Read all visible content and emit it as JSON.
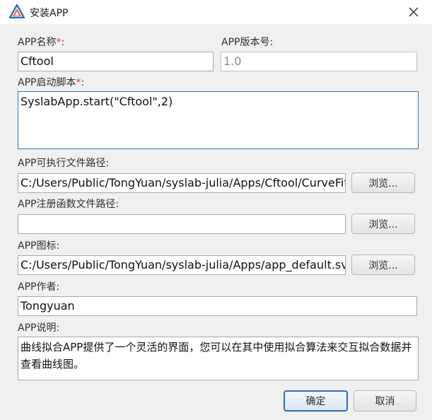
{
  "window": {
    "title": "安装APP"
  },
  "icons": {
    "logo": "app-logo-triangle-icon",
    "close": "close-icon"
  },
  "form": {
    "name": {
      "label": "APP名称",
      "required_mark": "*",
      "suffix": ":",
      "value": "Cftool"
    },
    "version": {
      "label": "APP版本号:",
      "value": "1.0"
    },
    "startup": {
      "label": "APP启动脚本",
      "required_mark": "*",
      "suffix": ":",
      "value": "SyslabApp.start(\"Cftool\",2)"
    },
    "exe_path": {
      "label": "APP可执行文件路径:",
      "value": "C:/Users/Public/TongYuan/syslab-julia/Apps/Cftool/CurveFitTool",
      "browse": "浏览..."
    },
    "reg_path": {
      "label": "APP注册函数文件路径:",
      "value": "",
      "browse": "浏览..."
    },
    "icon_path": {
      "label": "APP图标:",
      "value": "C:/Users/Public/TongYuan/syslab-julia/Apps/app_default.svg",
      "browse": "浏览..."
    },
    "author": {
      "label": "APP作者:",
      "value": "Tongyuan"
    },
    "description": {
      "label": "APP说明:",
      "value": "曲线拟合APP提供了一个灵活的界面，您可以在其中使用拟合算法来交互拟合数据并查看曲线图。"
    }
  },
  "buttons": {
    "ok": "确定",
    "cancel": "取消"
  },
  "colors": {
    "accent": "#2f6fb1",
    "required": "#e03a2e",
    "background": "#f0f0f0"
  }
}
